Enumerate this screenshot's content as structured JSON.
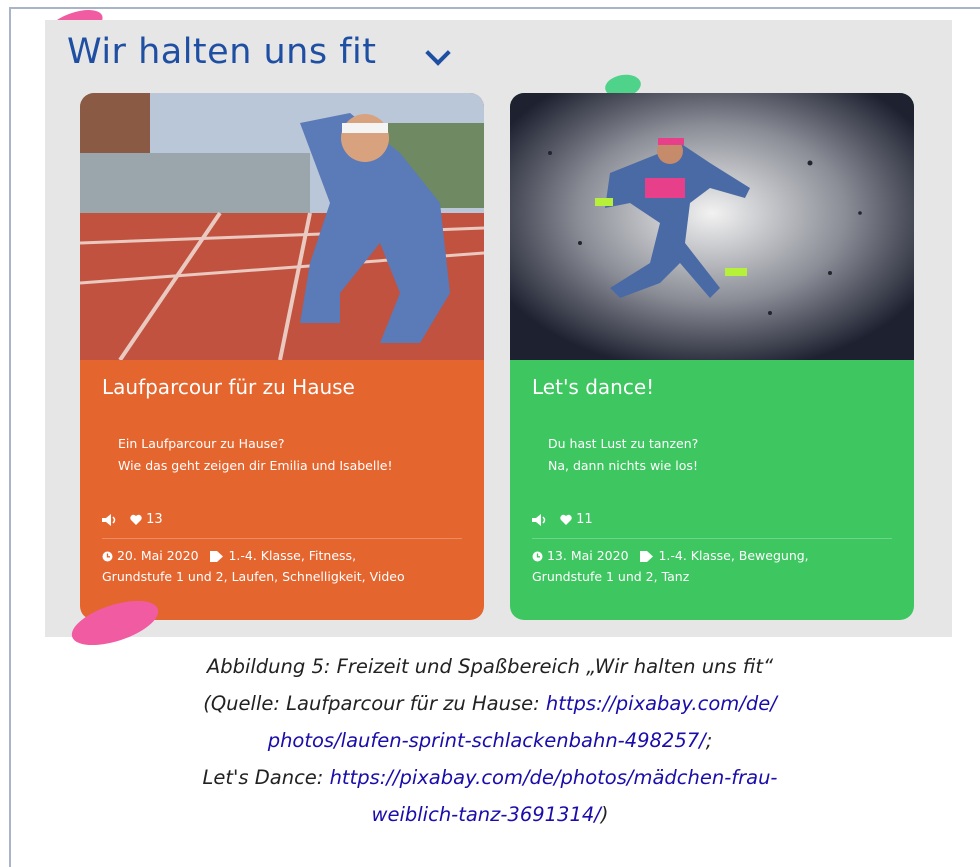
{
  "heading": "Wir halten uns fit",
  "cards": [
    {
      "title": "Laufparcour für zu Hause",
      "desc": [
        "Ein Laufparcour zu Hause?",
        "Wie das geht zeigen dir Emilia und Isabelle!"
      ],
      "likes": "13",
      "date": "20. Mai 2020",
      "tags_line1": "1.-4. Klasse, Fitness,",
      "tags_line2": "Grundstufe 1 und 2, Laufen, Schnelligkeit, Video",
      "color": "#e5652f"
    },
    {
      "title": "Let's dance!",
      "desc": [
        "Du hast Lust zu tanzen?",
        "Na, dann nichts wie los!"
      ],
      "likes": "11",
      "date": "13. Mai 2020",
      "tags_line1": "1.-4. Klasse, Bewegung,",
      "tags_line2": "Grundstufe 1 und 2, Tanz",
      "color": "#3ec761"
    }
  ],
  "caption": {
    "line1": "Abbildung 5: Freizeit und Spaßbereich „Wir halten uns fit“",
    "line2_prefix": "(Quelle: Laufparcour für zu Hause: ",
    "link1_part1": "https://pixabay.com/de/",
    "link1_part2": "photos/laufen-sprint-schlackenbahn-498257/",
    "line3_suffix": ";",
    "line4_prefix": "Let's Dance: ",
    "link2_part1": "https://pixabay.com/de/photos/mädchen-frau-",
    "link2_part2": "weiblich-tanz-3691314/",
    "line5_suffix": ")"
  },
  "colors": {
    "heading": "#1f4fa3",
    "link": "#1a0dab",
    "accent_pink": "#f15ba2"
  }
}
